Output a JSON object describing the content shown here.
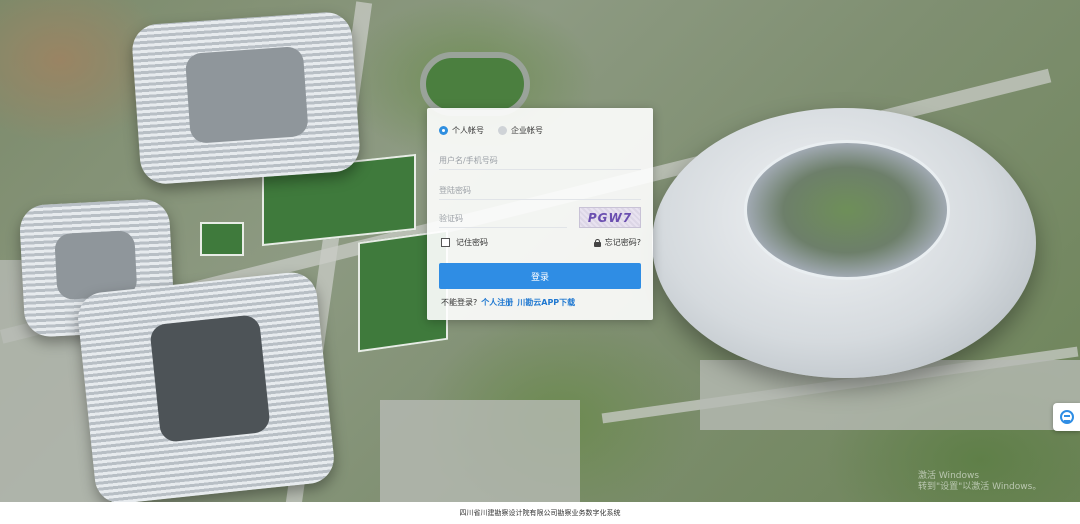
{
  "login": {
    "account_types": [
      "个人帐号",
      "企业帐号"
    ],
    "selected_account_type": "个人帐号",
    "username_placeholder": "用户名/手机号码",
    "password_placeholder": "登陆密码",
    "captcha_placeholder": "验证码",
    "captcha_text": "PGW7",
    "remember_label": "记住密码",
    "forgot_label": "忘记密码?",
    "submit_label": "登录",
    "no_login_text": "不能登录?",
    "register_link": "个人注册",
    "app_link": "川勘云APP下载"
  },
  "watermark": {
    "line1": "激活 Windows",
    "line2": "转到\"设置\"以激活 Windows。"
  },
  "footer": {
    "text": "四川省川建勘察设计院有限公司勘察业务数字化系统"
  },
  "colors": {
    "accent": "#2f8de4",
    "link": "#1f78d1"
  },
  "icons": {
    "forgot": "lock-icon",
    "side_widget": "refresh-icon"
  }
}
